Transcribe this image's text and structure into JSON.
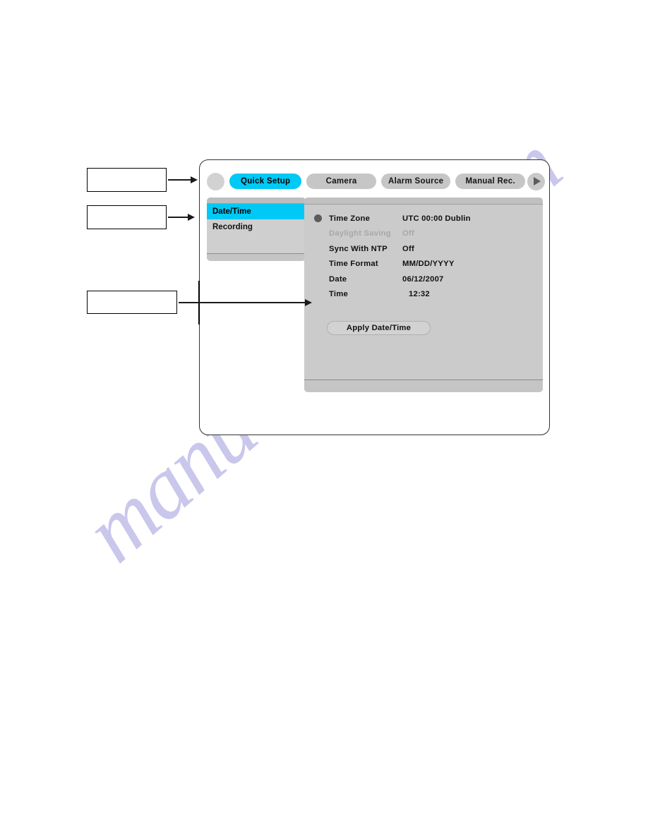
{
  "watermark": {
    "text": "manualshive.com"
  },
  "callouts": [
    {
      "name": "callout-box-1",
      "text": ""
    },
    {
      "name": "callout-box-2",
      "text": ""
    },
    {
      "name": "callout-box-3",
      "text": ""
    }
  ],
  "dialog": {
    "nav": {
      "prev_icon": "circle-icon",
      "next_icon": "triangle-right-icon"
    },
    "tabs": [
      {
        "label": "Quick Setup",
        "active": true
      },
      {
        "label": "Camera",
        "active": false
      },
      {
        "label": "Alarm Source",
        "active": false
      },
      {
        "label": "Manual Rec.",
        "active": false
      }
    ],
    "sidebar": {
      "items": [
        {
          "label": "Date/Time",
          "selected": true
        },
        {
          "label": "Recording",
          "selected": false
        }
      ]
    },
    "content": {
      "settings": [
        {
          "label": "Time Zone",
          "value": "UTC 00:00 Dublin",
          "bullet": true,
          "disabled": false
        },
        {
          "label": "Daylight Saving",
          "value": "Off",
          "bullet": false,
          "disabled": true
        },
        {
          "label": "Sync With NTP",
          "value": "Off",
          "bullet": false,
          "disabled": false
        },
        {
          "label": "Time Format",
          "value": "MM/DD/YYYY",
          "bullet": false,
          "disabled": false
        },
        {
          "label": "Date",
          "value": "06/12/2007",
          "bullet": false,
          "disabled": false
        },
        {
          "label": "Time",
          "value": "12:32",
          "bullet": false,
          "disabled": false
        }
      ],
      "apply_button_label": "Apply Date/Time"
    }
  },
  "colors": {
    "accent_cyan": "#00c9f5",
    "panel_gray": "#cbcbcb",
    "tab_gray": "#c6c6c6",
    "disabled_text": "#a8a8a8",
    "watermark": "#a9a6e0"
  }
}
